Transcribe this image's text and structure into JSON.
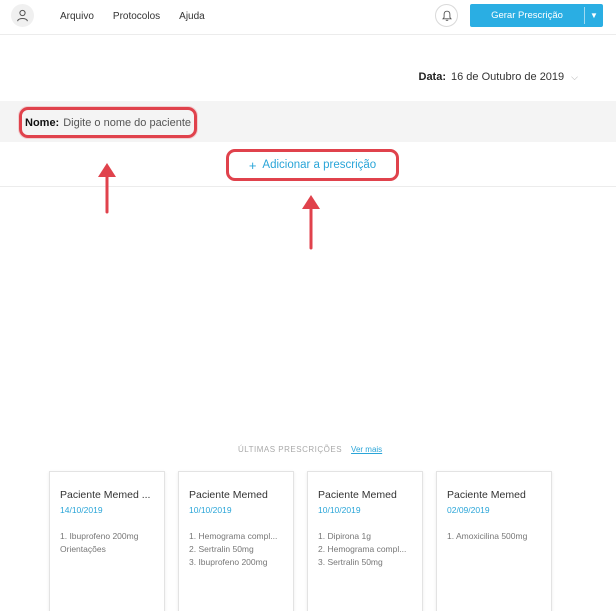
{
  "header": {
    "menu": [
      "Arquivo",
      "Protocolos",
      "Ajuda"
    ],
    "gerar_label": "Gerar Prescrição"
  },
  "date": {
    "label": "Data:",
    "value": "16 de Outubro de 2019"
  },
  "patient": {
    "label": "Nome:",
    "placeholder": "Digite o nome do paciente"
  },
  "add_prescription": "Adicionar a prescrição",
  "recent": {
    "title": "ÚLTIMAS PRESCRIÇÕES",
    "more": "Ver mais",
    "cards": [
      {
        "name": "Paciente Memed ...",
        "date": "14/10/2019",
        "items": [
          "1. Ibuprofeno 200mg",
          "Orientações"
        ]
      },
      {
        "name": "Paciente Memed",
        "date": "10/10/2019",
        "items": [
          "1. Hemograma compl...",
          "2. Sertralin 50mg",
          "3. Ibuprofeno 200mg"
        ]
      },
      {
        "name": "Paciente Memed",
        "date": "10/10/2019",
        "items": [
          "1. Dipirona 1g",
          "2. Hemograma compl...",
          "3. Sertralin 50mg"
        ]
      },
      {
        "name": "Paciente Memed",
        "date": "02/09/2019",
        "items": [
          "1. Amoxicilina 500mg"
        ]
      }
    ]
  },
  "colors": {
    "accent": "#2aaee3",
    "highlight": "#e0424c",
    "flag": "#f1b52e"
  },
  "icons": [
    "user-icon",
    "bell-icon",
    "caret-down-icon",
    "plus-icon",
    "chevron-down-icon",
    "arrow-up-icon"
  ]
}
